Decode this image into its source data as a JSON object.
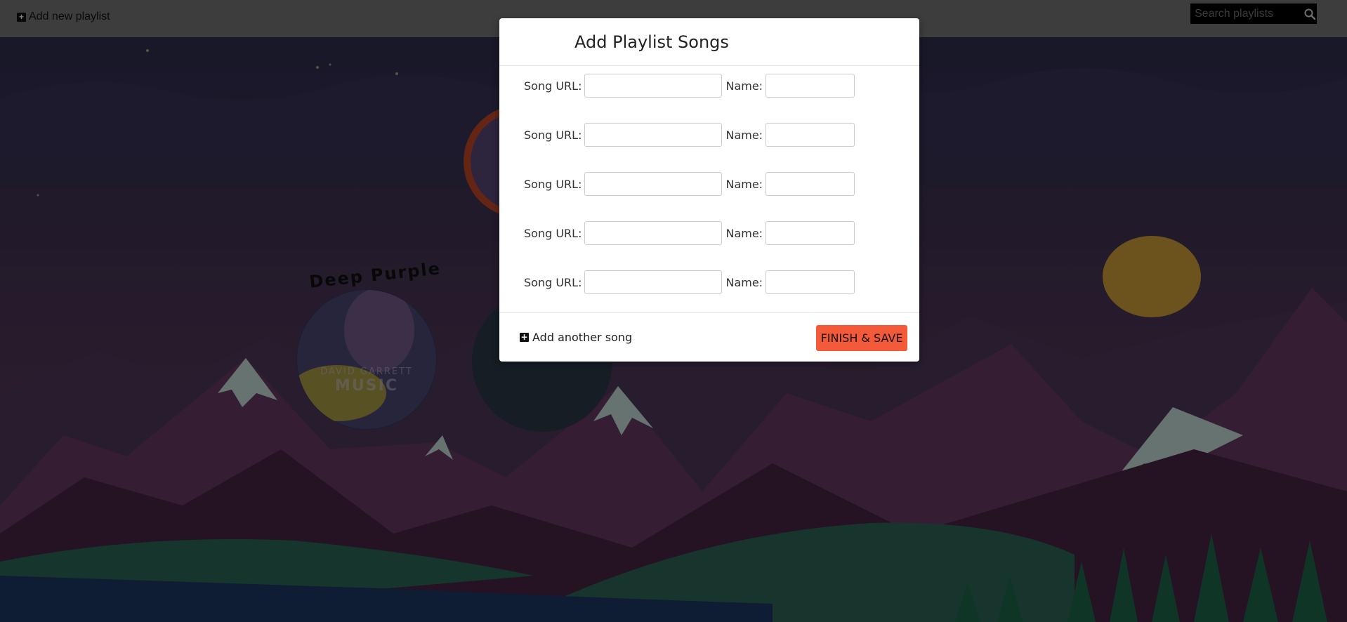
{
  "topbar": {
    "add_playlist_label": "Add new playlist",
    "search_placeholder": "Search playlists"
  },
  "background": {
    "album_caption": "Deep Purple",
    "album_cover_text_1": "DAVID GARRETT",
    "album_cover_text_2": "MUSIC"
  },
  "modal": {
    "title": "Add Playlist Songs",
    "song_url_label": "Song URL:",
    "name_label": "Name:",
    "rows": [
      {
        "url": "",
        "name": ""
      },
      {
        "url": "",
        "name": ""
      },
      {
        "url": "",
        "name": ""
      },
      {
        "url": "",
        "name": ""
      },
      {
        "url": "",
        "name": ""
      }
    ],
    "add_song_label": "Add another song",
    "finish_label": "FINISH & SAVE"
  },
  "colors": {
    "accent": "#f35a3a",
    "topbar": "#7b7b7b"
  }
}
